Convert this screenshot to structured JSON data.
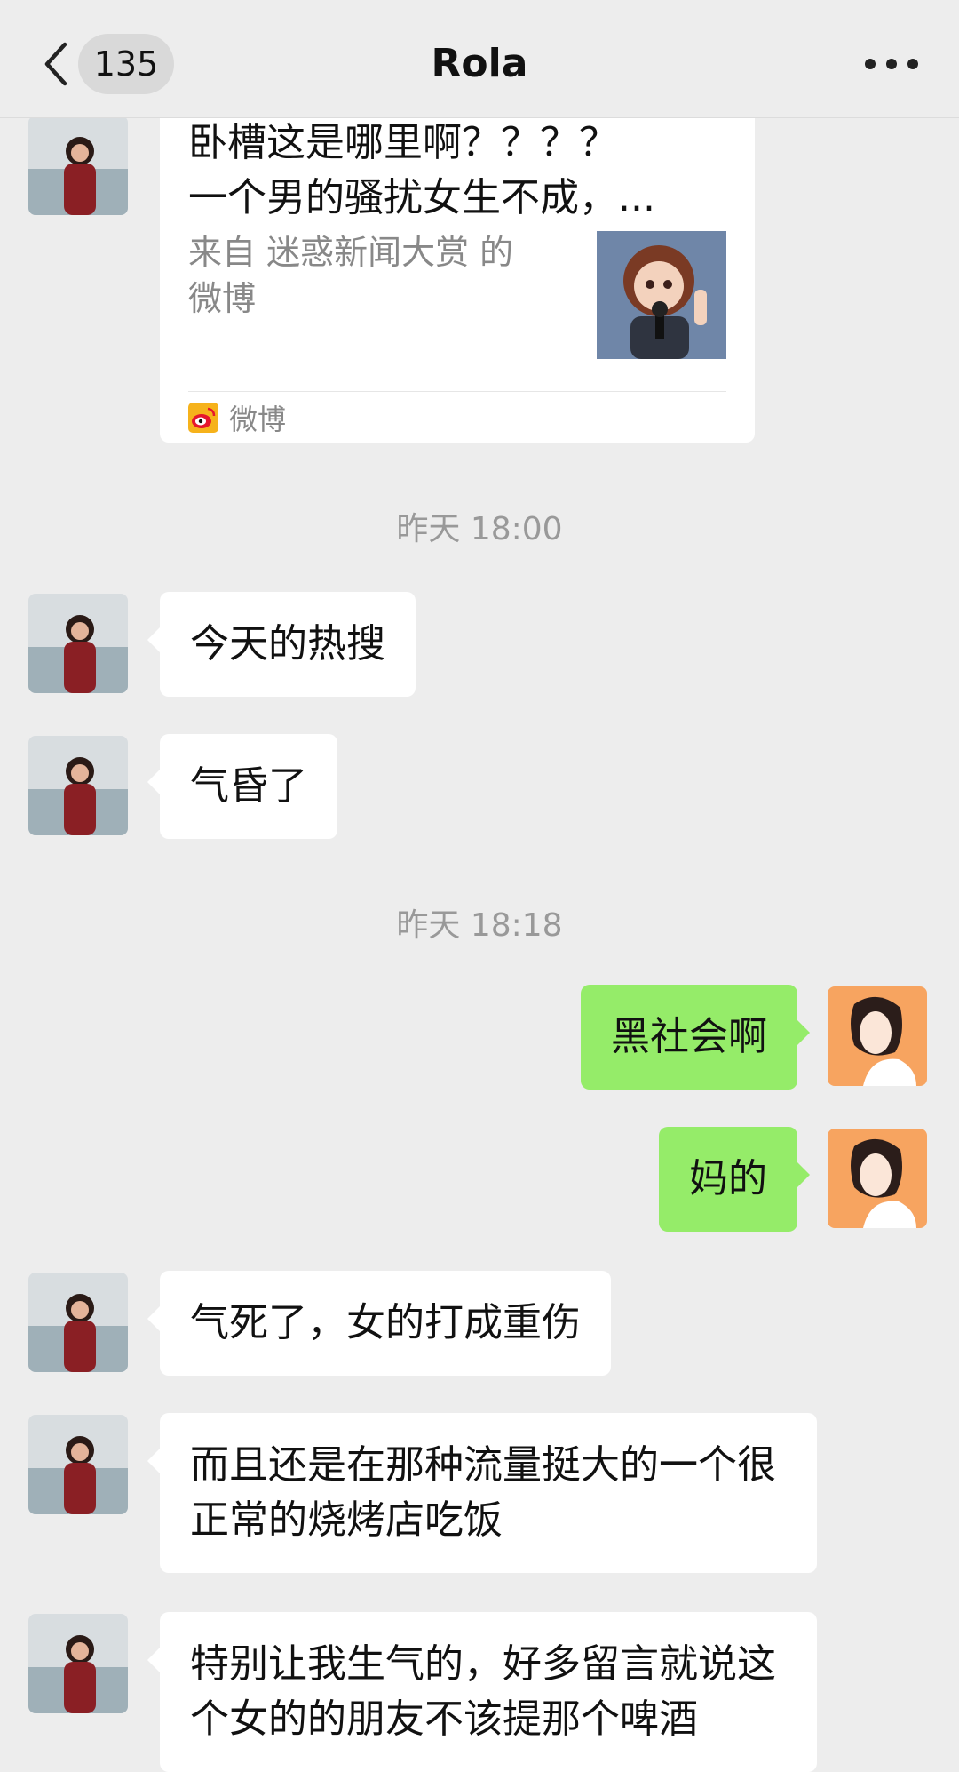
{
  "header": {
    "unread_count": "135",
    "title": "Rola"
  },
  "link_card": {
    "title": "卧槽这是哪里啊？？？？\n一个男的骚扰女生不成，...",
    "description": "来自 迷惑新闻大赏 的微博",
    "source": "微博"
  },
  "timestamps": [
    "昨天 18:00",
    "昨天 18:18"
  ],
  "messages": [
    {
      "from": "Rola",
      "text": "今天的热搜"
    },
    {
      "from": "Rola",
      "text": "气昏了"
    },
    {
      "from": "me",
      "text": "黑社会啊"
    },
    {
      "from": "me",
      "text": "妈的"
    },
    {
      "from": "Rola",
      "text": "气死了，女的打成重伤"
    },
    {
      "from": "Rola",
      "text": "而且还是在那种流量挺大的一个很正常的烧烤店吃饭"
    },
    {
      "from": "Rola",
      "text": "特别让我生气的，好多留言就说这个女的的朋友不该提那个啤酒"
    }
  ],
  "colors": {
    "background": "#ededed",
    "incoming_bubble": "#ffffff",
    "outgoing_bubble": "#95ec69",
    "timestamp_text": "#999999"
  },
  "icons": [
    "back-chevron-icon",
    "more-dots-icon",
    "weibo-icon"
  ]
}
